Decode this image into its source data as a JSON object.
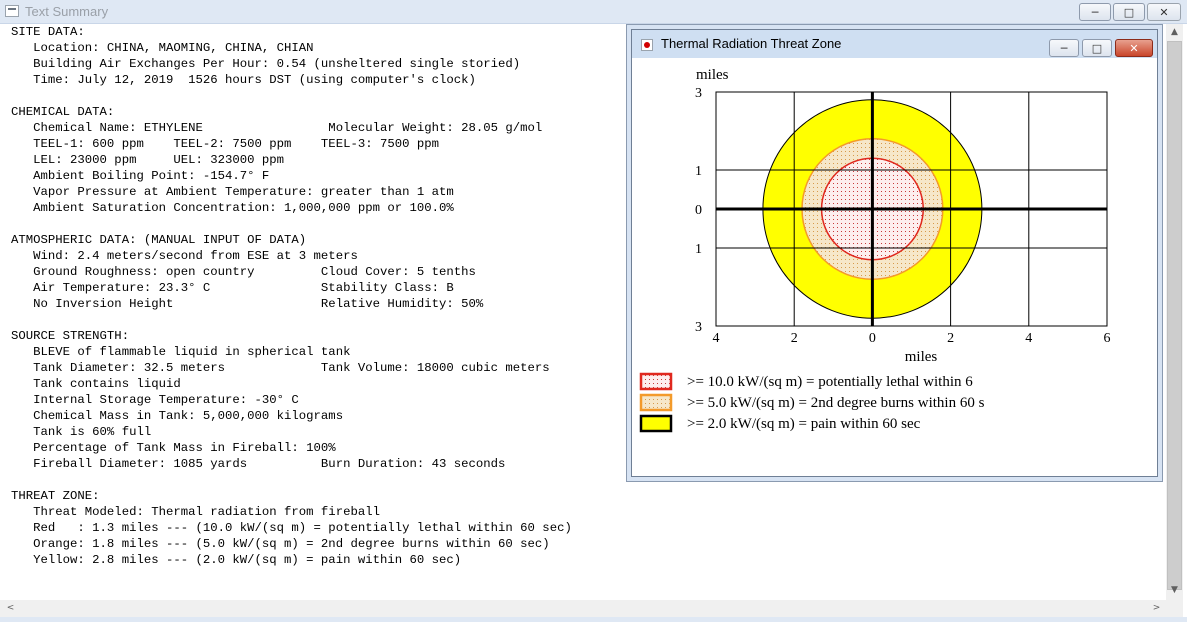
{
  "outer_window": {
    "title": "Text Summary",
    "min_glyph": "─",
    "max_glyph": "□",
    "close_glyph": "✕"
  },
  "summary_lines": [
    "SITE DATA:",
    "   Location: CHINA, MAOMING, CHINA, CHIAN",
    "   Building Air Exchanges Per Hour: 0.54 (unsheltered single storied)",
    "   Time: July 12, 2019  1526 hours DST (using computer's clock)",
    "",
    "CHEMICAL DATA:",
    "   Chemical Name: ETHYLENE                 Molecular Weight: 28.05 g/mol",
    "   TEEL-1: 600 ppm    TEEL-2: 7500 ppm    TEEL-3: 7500 ppm",
    "   LEL: 23000 ppm     UEL: 323000 ppm",
    "   Ambient Boiling Point: -154.7° F",
    "   Vapor Pressure at Ambient Temperature: greater than 1 atm",
    "   Ambient Saturation Concentration: 1,000,000 ppm or 100.0%",
    "",
    "ATMOSPHERIC DATA: (MANUAL INPUT OF DATA)",
    "   Wind: 2.4 meters/second from ESE at 3 meters",
    "   Ground Roughness: open country         Cloud Cover: 5 tenths",
    "   Air Temperature: 23.3° C               Stability Class: B",
    "   No Inversion Height                    Relative Humidity: 50%",
    "",
    "SOURCE STRENGTH:",
    "   BLEVE of flammable liquid in spherical tank",
    "   Tank Diameter: 32.5 meters             Tank Volume: 18000 cubic meters",
    "   Tank contains liquid",
    "   Internal Storage Temperature: -30° C",
    "   Chemical Mass in Tank: 5,000,000 kilograms",
    "   Tank is 60% full",
    "   Percentage of Tank Mass in Fireball: 100%",
    "   Fireball Diameter: 1085 yards          Burn Duration: 43 seconds",
    "",
    "THREAT ZONE:",
    "   Threat Modeled: Thermal radiation from fireball",
    "   Red   : 1.3 miles --- (10.0 kW/(sq m) = potentially lethal within 60 sec)",
    "   Orange: 1.8 miles --- (5.0 kW/(sq m) = 2nd degree burns within 60 sec)",
    "   Yellow: 2.8 miles --- (2.0 kW/(sq m) = pain within 60 sec)"
  ],
  "threat_window": {
    "title": "Thermal Radiation Threat Zone",
    "min_glyph": "─",
    "max_glyph": "□",
    "close_glyph": "✕"
  },
  "chart_data": {
    "type": "threat-zone-map",
    "y_unit_label": "miles",
    "x_unit_label": "miles",
    "xlim": [
      -4,
      6
    ],
    "ylim": [
      -3,
      3
    ],
    "x_ticks": [
      {
        "v": -4,
        "label": "4"
      },
      {
        "v": -2,
        "label": "2"
      },
      {
        "v": 0,
        "label": "0"
      },
      {
        "v": 2,
        "label": "2"
      },
      {
        "v": 4,
        "label": "4"
      },
      {
        "v": 6,
        "label": "6"
      }
    ],
    "y_ticks": [
      {
        "v": 3,
        "label": "3"
      },
      {
        "v": 1,
        "label": "1"
      },
      {
        "v": 0,
        "label": "0"
      },
      {
        "v": -1,
        "label": "1"
      },
      {
        "v": -3,
        "label": "3"
      }
    ],
    "grid": true,
    "zones": [
      {
        "name": "yellow",
        "radius_miles": 2.8,
        "fill": "#ffff00",
        "stroke": "#000000",
        "pattern": "solid"
      },
      {
        "name": "orange",
        "radius_miles": 1.8,
        "fill": "#f6e7c9",
        "stroke": "#f39a2a",
        "pattern": "dots-orange"
      },
      {
        "name": "red",
        "radius_miles": 1.3,
        "fill": "#fdeeee",
        "stroke": "#e0281e",
        "pattern": "dots-red"
      }
    ],
    "legend": [
      {
        "swatch_color": "#e0281e",
        "swatch_fill": "#fdeeee",
        "text": ">= 10.0 kW/(sq m) = potentially lethal within 6"
      },
      {
        "swatch_color": "#f39a2a",
        "swatch_fill": "#f6e7c9",
        "text": ">= 5.0 kW/(sq m) = 2nd degree burns within 60 s"
      },
      {
        "swatch_color": "#000000",
        "swatch_fill": "#ffff00",
        "text": ">= 2.0 kW/(sq m) = pain within 60 sec"
      }
    ]
  }
}
